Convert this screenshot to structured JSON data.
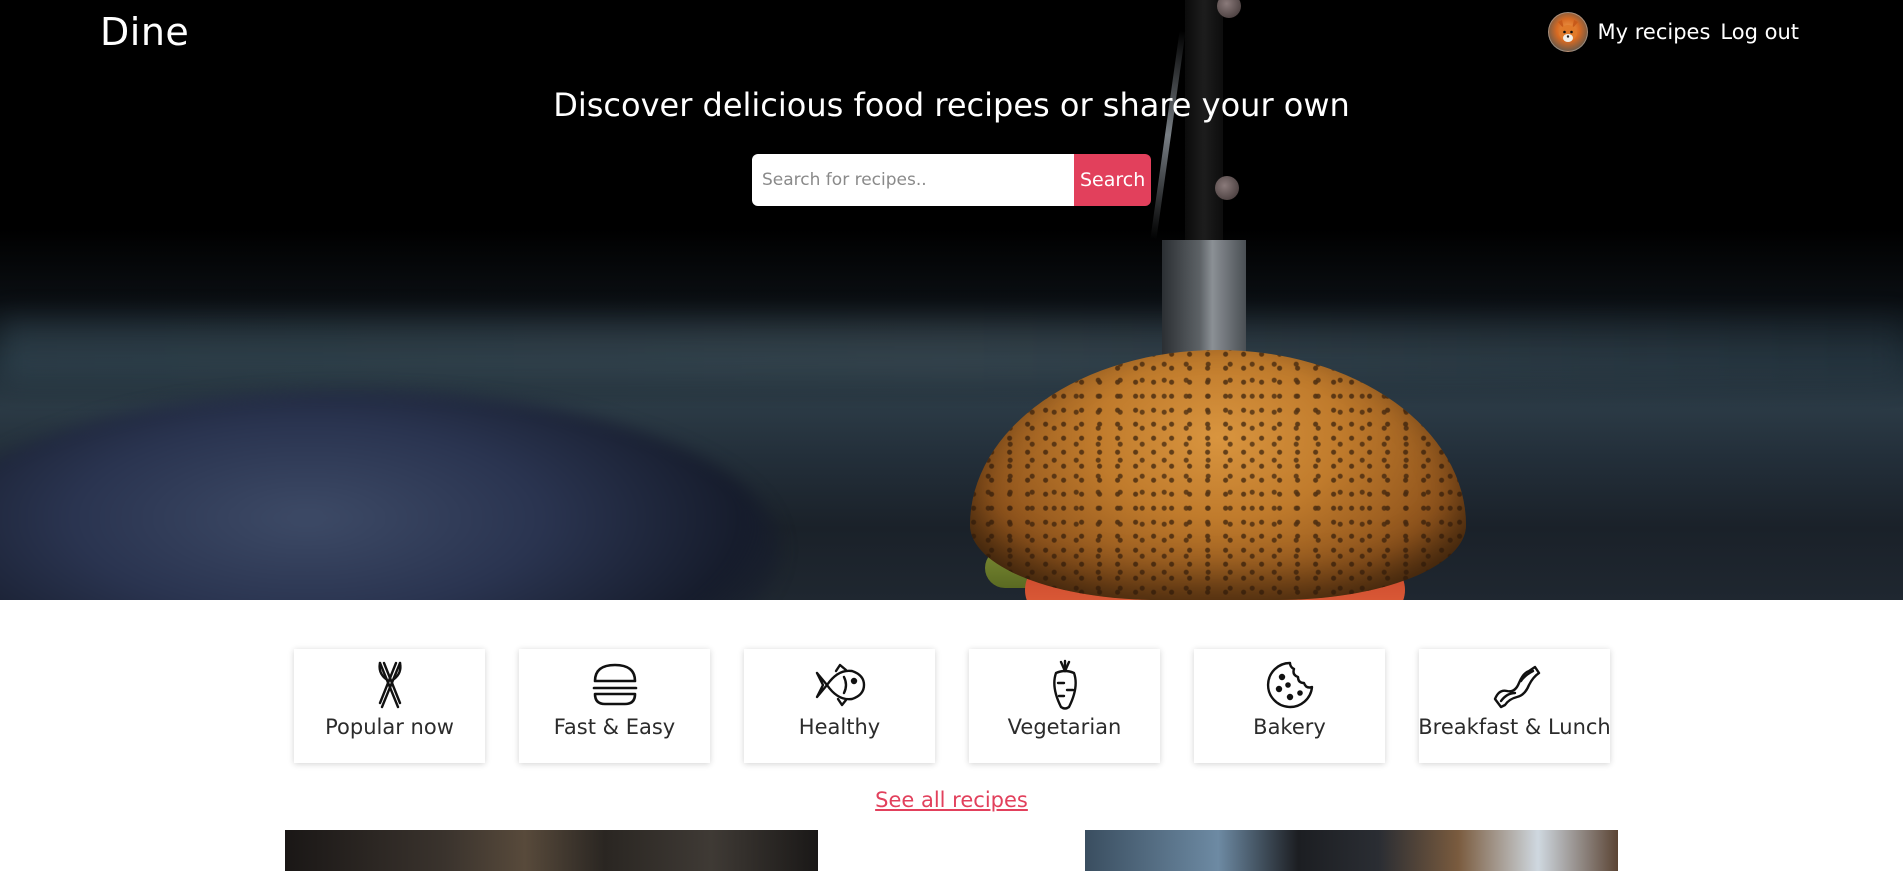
{
  "nav": {
    "brand": "Dine",
    "my_recipes": "My recipes",
    "log_out": "Log out"
  },
  "hero": {
    "title": "Discover delicious food recipes or share your own",
    "search_placeholder": "Search for recipes..",
    "search_button": "Search"
  },
  "categories": [
    {
      "label": "Popular now",
      "icon": "utensils-icon"
    },
    {
      "label": "Fast & Easy",
      "icon": "burger-icon"
    },
    {
      "label": "Healthy",
      "icon": "fish-icon"
    },
    {
      "label": "Vegetarian",
      "icon": "carrot-icon"
    },
    {
      "label": "Bakery",
      "icon": "cookie-icon"
    },
    {
      "label": "Breakfast & Lunch",
      "icon": "bacon-icon"
    }
  ],
  "see_all": "See all recipes",
  "colors": {
    "accent": "#e2405c",
    "text": "#2b2b2b"
  }
}
